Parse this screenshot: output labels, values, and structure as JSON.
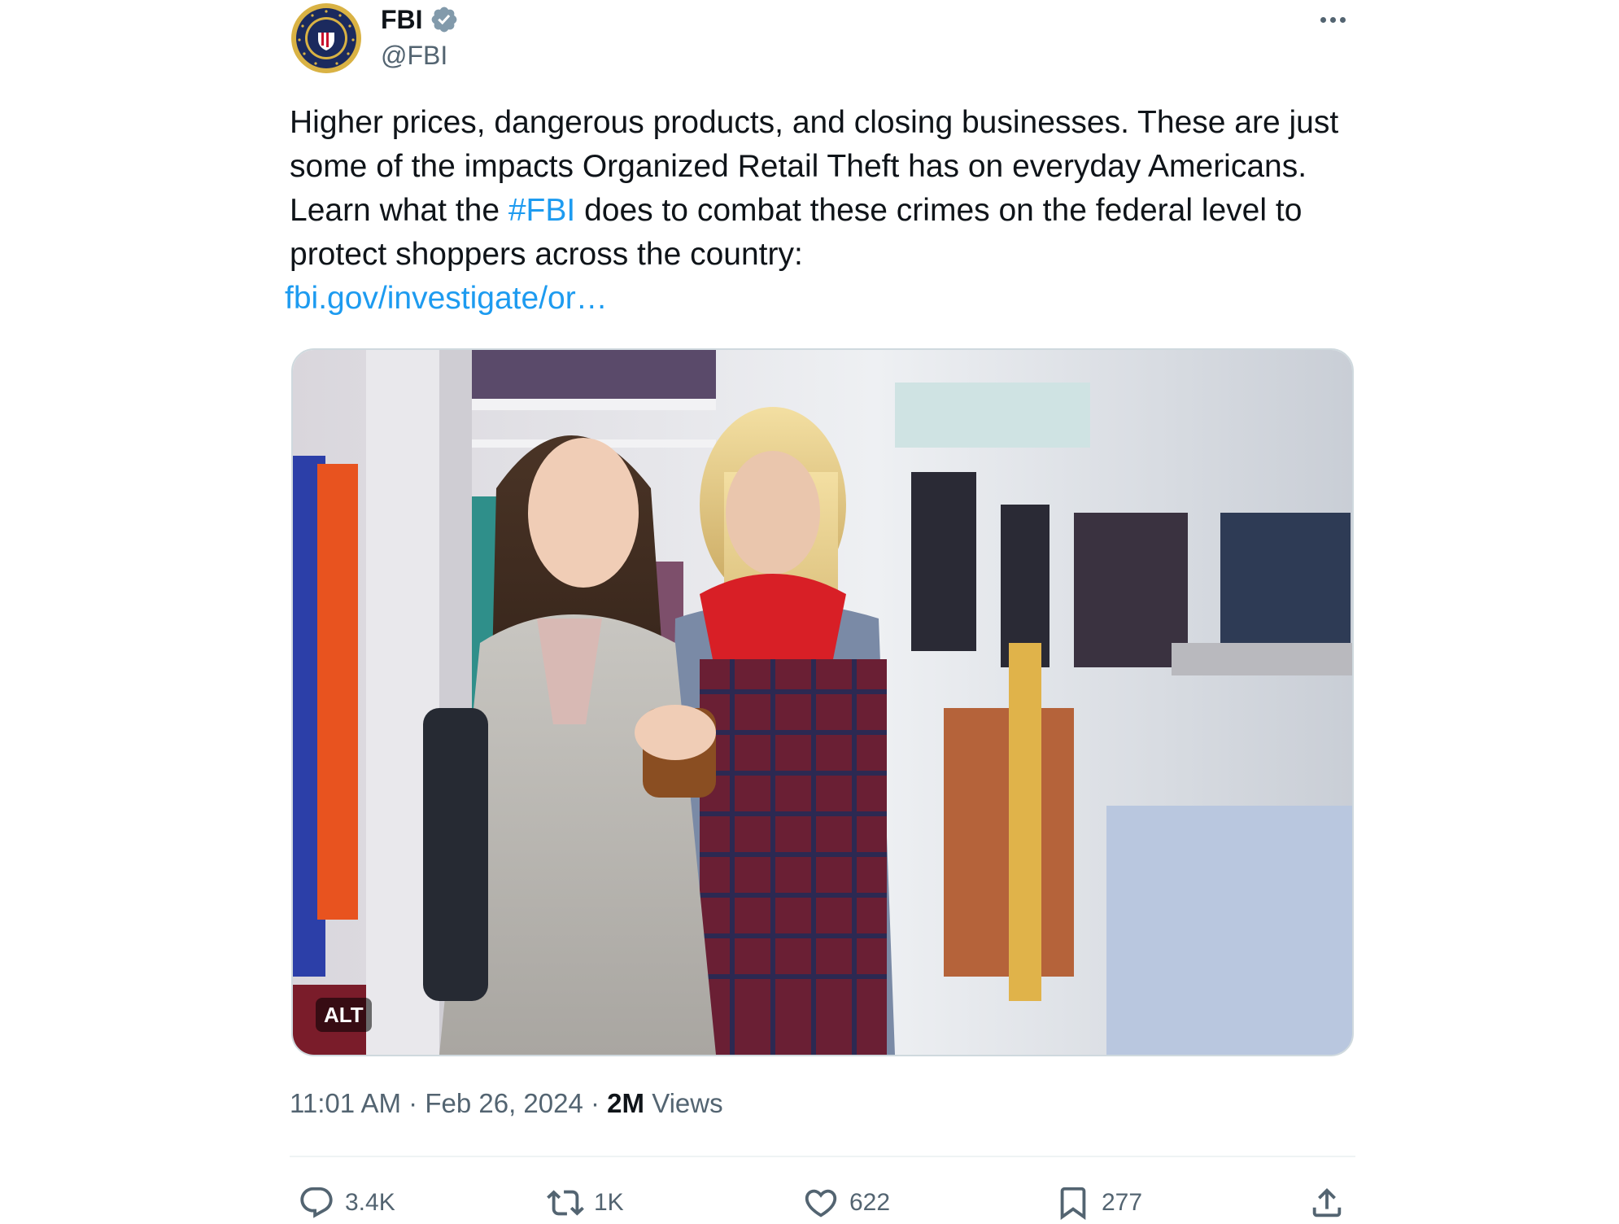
{
  "author": {
    "display_name": "FBI",
    "handle": "@FBI",
    "avatar_icon": "fbi-seal-icon",
    "verified_icon": "verified-badge-icon",
    "verified_color": "#829aab"
  },
  "tweet": {
    "text_part1": "Higher prices, dangerous products, and closing businesses. These are just some of the impacts Organized Retail Theft has on everyday Americans. Learn what the ",
    "hashtag": "#FBI",
    "text_part2": " does to combat these crimes on the federal level to protect shoppers across the country:",
    "link_text": "fbi.gov/investigate/or…",
    "link_color": "#1d9bf0"
  },
  "media": {
    "alt_label": "ALT"
  },
  "meta": {
    "time": "11:01 AM",
    "separator": "·",
    "date": "Feb 26, 2024",
    "views_count": "2M",
    "views_label": "Views"
  },
  "actions": {
    "replies": "3.4K",
    "reposts": "1K",
    "likes": "622",
    "bookmarks": "277"
  },
  "icons": {
    "more": "more-options-icon",
    "reply": "reply-icon",
    "repost": "repost-icon",
    "like": "heart-icon",
    "bookmark": "bookmark-icon",
    "share": "share-icon"
  }
}
